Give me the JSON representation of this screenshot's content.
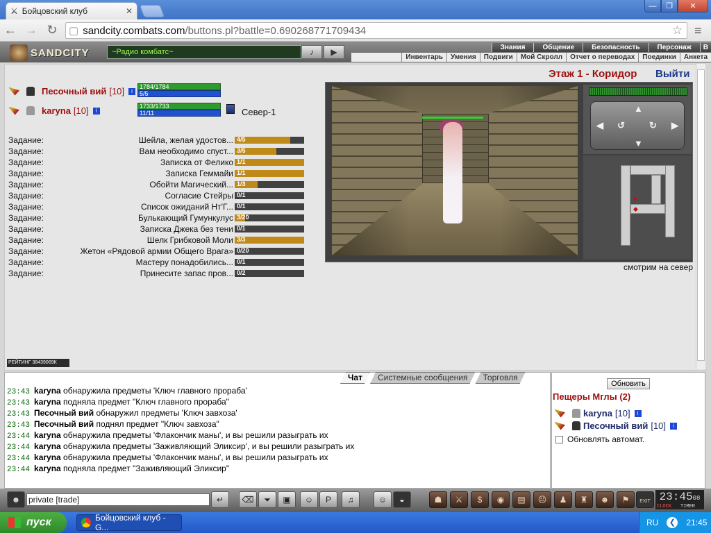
{
  "browser": {
    "tab_title": "Бойцовский клуб",
    "url_host": "sandcity.combats.com",
    "url_path": "/buttons.pl?battle=0.690268771709434"
  },
  "game": {
    "logo": "SANDCITY",
    "radio": "~Радио комбатс~",
    "menu_top": [
      "Знания",
      "Общение",
      "Безопасность",
      "Персонаж",
      "В"
    ],
    "menu_bottom": [
      "Инвентарь",
      "Умения",
      "Подвиги",
      "Мой Скролл",
      "Отчет о переводах",
      "Поединки",
      "Анкета"
    ],
    "location": "Этаж 1 - Коридор",
    "exit": "Выйти",
    "facing": "смотрим на север",
    "rating": "РЕЙТИНГ 38439069К",
    "players": [
      {
        "name": "Песочный вий",
        "level": "[10]",
        "hp": "1784/1784",
        "mp": "5/5"
      },
      {
        "name": "karyna",
        "level": "[10]",
        "hp": "1733/1733",
        "mp": "11/11",
        "direction": "Север-1"
      }
    ],
    "tasks": [
      {
        "label": "Задание:",
        "text": "Шейла, желая удостов...",
        "progress": "4/5",
        "frac": 0.8
      },
      {
        "label": "Задание:",
        "text": "Вам необходимо спуст...",
        "progress": "3/5",
        "frac": 0.6
      },
      {
        "label": "Задание:",
        "text": "Записка от Фелико",
        "progress": "1/1",
        "frac": 1
      },
      {
        "label": "Задание:",
        "text": "Записка Геммайи",
        "progress": "1/1",
        "frac": 1
      },
      {
        "label": "Задание:",
        "text": "Обойти Магический...",
        "progress": "1/3",
        "frac": 0.33
      },
      {
        "label": "Задание:",
        "text": "Согласие Стейры",
        "progress": "0/1",
        "frac": 0
      },
      {
        "label": "Задание:",
        "text": "Список ожиданий Нт'Г...",
        "progress": "0/1",
        "frac": 0
      },
      {
        "label": "Задание:",
        "text": "Булькающий Гумункулус",
        "progress": "3/20",
        "frac": 0.15
      },
      {
        "label": "Задание:",
        "text": "Записка Джека без тени",
        "progress": "0/1",
        "frac": 0
      },
      {
        "label": "Задание:",
        "text": "Шелк Грибковой Моли",
        "progress": "3/3",
        "frac": 1
      },
      {
        "label": "Задание:",
        "text": "Жетон «Рядовой армии Общего Врага»",
        "progress": "0/20",
        "frac": 0
      },
      {
        "label": "Задание:",
        "text": "Мастеру понадобились...",
        "progress": "0/1",
        "frac": 0
      },
      {
        "label": "Задание:",
        "text": "Принесите запас пров...",
        "progress": "0/2",
        "frac": 0
      }
    ]
  },
  "chat": {
    "tabs": [
      "Чат",
      "Системные сообщения",
      "Торговля"
    ],
    "lines": [
      {
        "time": "23:43",
        "user": "karyna",
        "msg": " обнаружила предметы 'Ключ главного прораба'"
      },
      {
        "time": "23:43",
        "user": "karyna",
        "msg": " подняла предмет \"Ключ главного прораба\""
      },
      {
        "time": "23:43",
        "user": "Песочный вий",
        "msg": " обнаружил предметы 'Ключ завхоза'"
      },
      {
        "time": "23:43",
        "user": "Песочный вий",
        "msg": " поднял предмет \"Ключ завхоза\""
      },
      {
        "time": "23:44",
        "user": "karyna",
        "msg": " обнаружила предметы 'Флакончик маны', и вы решили разыграть их"
      },
      {
        "time": "23:44",
        "user": "karyna",
        "msg": " обнаружила предметы 'Заживляющий Эликсир', и вы решили разыграть их"
      },
      {
        "time": "23:44",
        "user": "karyna",
        "msg": " обнаружила предметы 'Флакончик маны', и вы решили разыграть их"
      },
      {
        "time": "23:44",
        "user": "karyna",
        "msg": " подняла предмет \"Заживляющий Эликсир\""
      }
    ],
    "input": "private [trade]"
  },
  "side": {
    "refresh": "Обновить",
    "title": "Пещеры Мглы (2)",
    "members": [
      {
        "name": "karyna",
        "level": "[10]"
      },
      {
        "name": "Песочный вий",
        "level": "[10]"
      }
    ],
    "auto": "Обновлять автомат."
  },
  "clock": {
    "time": "23:45",
    "sec": "08",
    "l1": "CLOCK",
    "l2": "TIMER",
    "exit": "EXIT"
  },
  "taskbar": {
    "start": "пуск",
    "task": "Бойцовский клуб - G...",
    "lang": "RU",
    "time": "21:45"
  }
}
